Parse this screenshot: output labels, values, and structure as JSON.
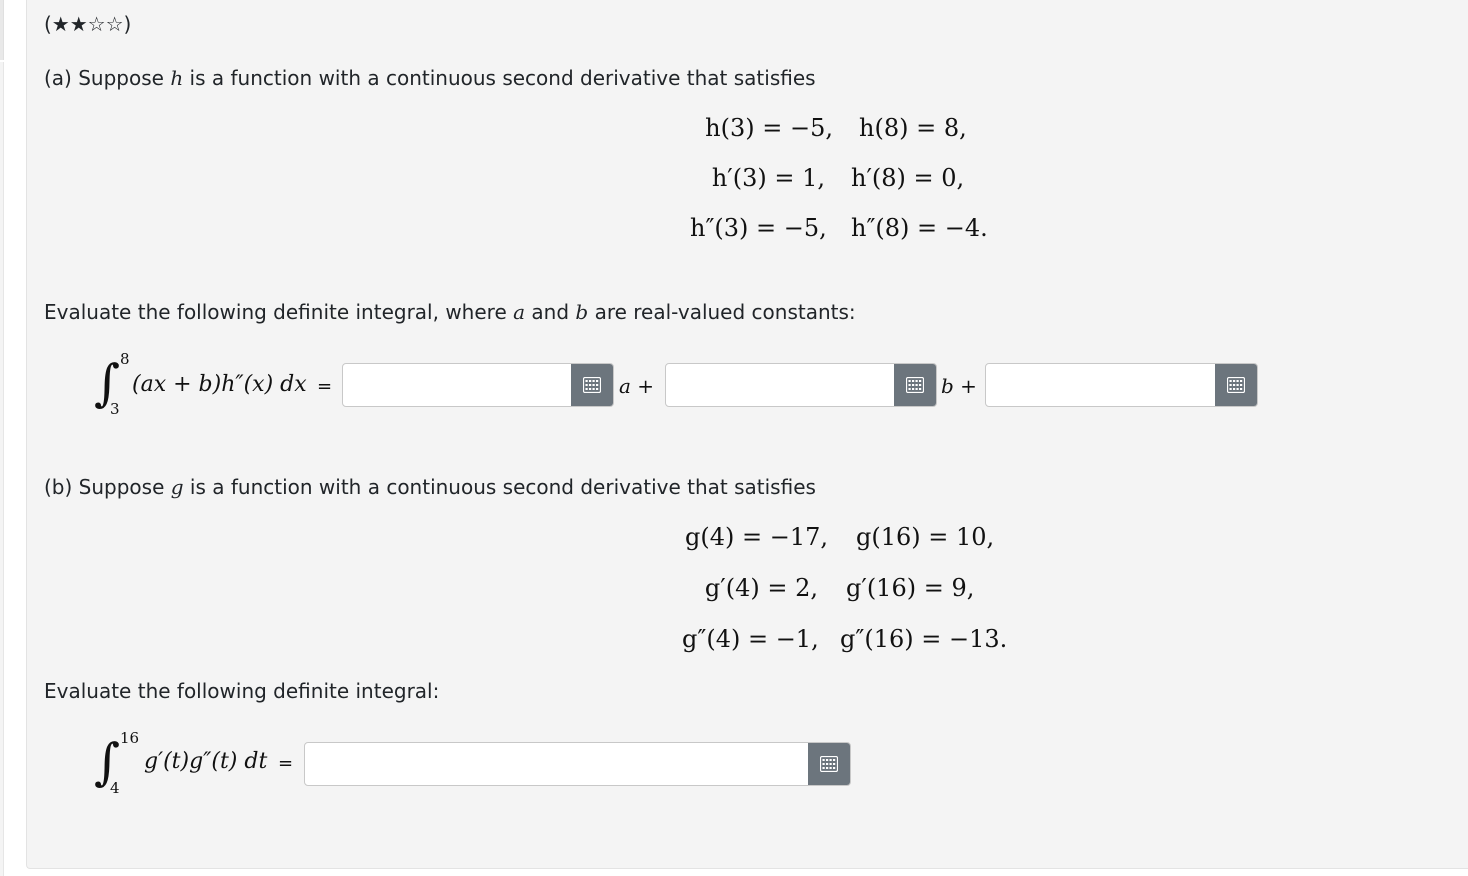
{
  "difficulty": "(★★☆☆)",
  "part_a": {
    "intro_before": "(a) Suppose ",
    "func": "h",
    "intro_after": " is a function with a continuous second derivative that satisfies",
    "conditions": [
      [
        "h(3) = −5,",
        "h(8) = 8,"
      ],
      [
        "h′(3) = 1,",
        "h′(8) = 0,"
      ],
      [
        "h″(3) = −5,",
        "h″(8) = −4."
      ]
    ],
    "eval_before": "Evaluate the following definite integral, where ",
    "var_a": "a",
    "eval_mid": " and ",
    "var_b": "b",
    "eval_after": " are real-valued constants:",
    "integral": {
      "upper": "8",
      "lower": "3",
      "integrand": "(ax + b)h″(x) dx",
      "equals": "="
    },
    "answer1_value": "",
    "answer2_value": "",
    "answer3_value": "",
    "term_a": "a +",
    "term_b": "b +"
  },
  "part_b": {
    "intro_before": "(b) Suppose ",
    "func": "g",
    "intro_after": " is a function with a continuous second derivative that satisfies",
    "conditions": [
      [
        "g(4) = −17,",
        "g(16) = 10,"
      ],
      [
        "g′(4) = 2,",
        "g′(16) = 9,"
      ],
      [
        "g″(4) = −1,",
        "g″(16) = −13."
      ]
    ],
    "eval_text": "Evaluate the following definite integral:",
    "integral": {
      "upper": "16",
      "lower": "4",
      "integrand": "g′(t)g″(t) dt",
      "equals": "="
    },
    "answer_value": ""
  },
  "icons": {
    "keyboard": "keyboard-icon"
  },
  "colors": {
    "panel_bg": "#f4f4f4",
    "button_bg": "#6c757d",
    "text": "#212529"
  }
}
